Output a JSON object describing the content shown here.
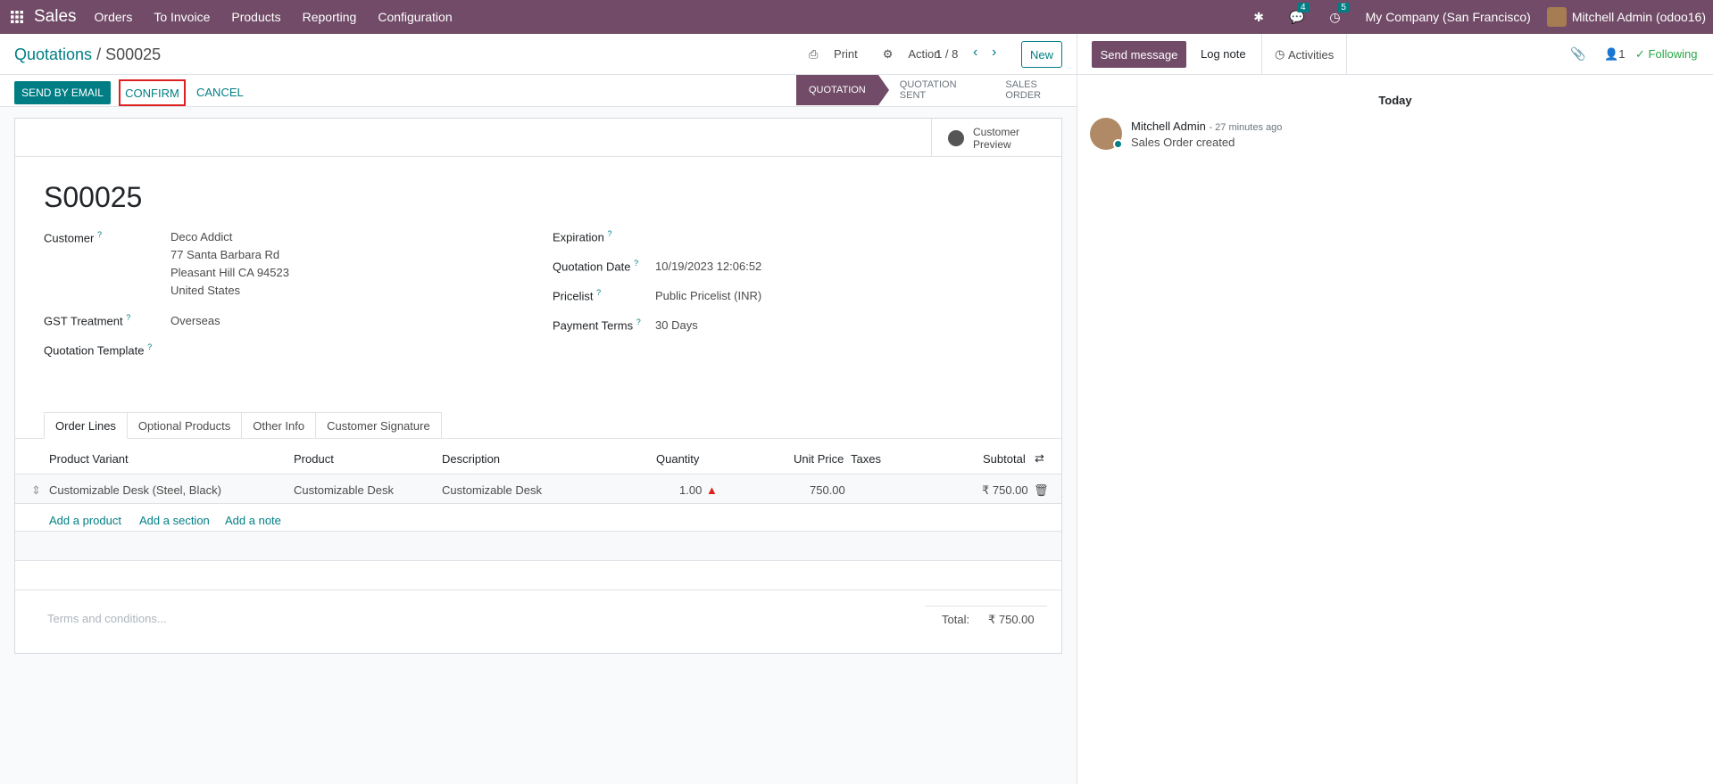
{
  "topbar": {
    "app_name": "Sales",
    "menus": [
      "Orders",
      "To Invoice",
      "Products",
      "Reporting",
      "Configuration"
    ],
    "messages_badge": "4",
    "activities_badge": "5",
    "company": "My Company (San Francisco)",
    "user": "Mitchell Admin (odoo16)"
  },
  "control_panel": {
    "breadcrumb_parent": "Quotations",
    "breadcrumb_sep": "/",
    "breadcrumb_current": "S00025",
    "print_label": "Print",
    "action_label": "Action",
    "pager": "1 / 8",
    "new_label": "New"
  },
  "statusbar": {
    "send_by_email": "SEND BY EMAIL",
    "confirm": "CONFIRM",
    "cancel": "CANCEL",
    "stages": [
      "QUOTATION",
      "QUOTATION SENT",
      "SALES ORDER"
    ]
  },
  "form": {
    "customer_preview": [
      "Customer",
      "Preview"
    ],
    "title": "S00025",
    "customer_label": "Customer",
    "customer_lines": [
      "Deco Addict",
      "77 Santa Barbara Rd",
      "Pleasant Hill CA 94523",
      "United States"
    ],
    "gst_label": "GST Treatment",
    "gst_value": "Overseas",
    "template_label": "Quotation Template",
    "expiration_label": "Expiration",
    "quotation_date_label": "Quotation Date",
    "quotation_date_value": "10/19/2023 12:06:52",
    "pricelist_label": "Pricelist",
    "pricelist_value": "Public Pricelist (INR)",
    "payment_terms_label": "Payment Terms",
    "payment_terms_value": "30 Days",
    "help_mark": "?"
  },
  "tabs": [
    "Order Lines",
    "Optional Products",
    "Other Info",
    "Customer Signature"
  ],
  "table": {
    "headers": [
      "Product Variant",
      "Product",
      "Description",
      "Quantity",
      "Unit Price",
      "Taxes",
      "Subtotal"
    ],
    "rows": [
      {
        "variant": "Customizable Desk (Steel, Black)",
        "product": "Customizable Desk",
        "description": "Customizable Desk",
        "quantity": "1.00",
        "unit_price": "750.00",
        "taxes": "",
        "subtotal": "₹ 750.00"
      }
    ],
    "add_links": [
      "Add a product",
      "Add a section",
      "Add a note"
    ]
  },
  "footer": {
    "terms_placeholder": "Terms and conditions...",
    "total_label": "Total:",
    "total_value": "₹ 750.00"
  },
  "chatter": {
    "send_message": "Send message",
    "log_note": "Log note",
    "activities": "Activities",
    "followers_count": "1",
    "following": "Following",
    "day_label": "Today",
    "message": {
      "author": "Mitchell Admin",
      "time": "- 27 minutes ago",
      "body": "Sales Order created"
    }
  },
  "colors": {
    "brand": "#714b67",
    "accent": "#017e84",
    "highlight": "#e02020"
  }
}
